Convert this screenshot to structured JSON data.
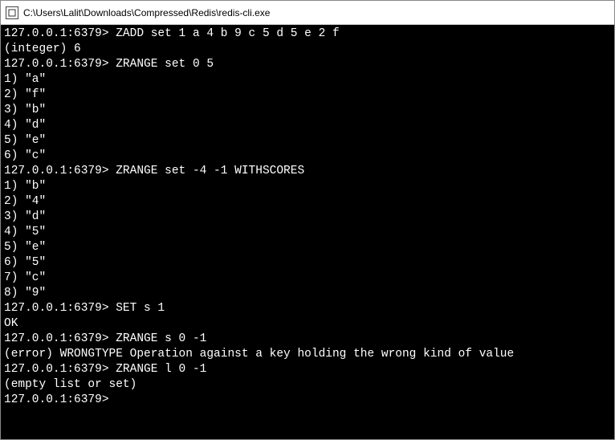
{
  "window": {
    "title": "C:\\Users\\Lalit\\Downloads\\Compressed\\Redis\\redis-cli.exe"
  },
  "terminal": {
    "prompt": "127.0.0.1:6379>",
    "blocks": [
      {
        "command": "ZADD set 1 a 4 b 9 c 5 d 5 e 2 f",
        "output": [
          "(integer) 6"
        ]
      },
      {
        "command": "ZRANGE set 0 5",
        "output": [
          "1) \"a\"",
          "2) \"f\"",
          "3) \"b\"",
          "4) \"d\"",
          "5) \"e\"",
          "6) \"c\""
        ]
      },
      {
        "command": "ZRANGE set -4 -1 WITHSCORES",
        "output": [
          "1) \"b\"",
          "2) \"4\"",
          "3) \"d\"",
          "4) \"5\"",
          "5) \"e\"",
          "6) \"5\"",
          "7) \"c\"",
          "8) \"9\""
        ]
      },
      {
        "command": "SET s 1",
        "output": [
          "OK"
        ]
      },
      {
        "command": "ZRANGE s 0 -1",
        "output": [
          "(error) WRONGTYPE Operation against a key holding the wrong kind of value"
        ]
      },
      {
        "command": "ZRANGE l 0 -1",
        "output": [
          "(empty list or set)"
        ]
      }
    ]
  }
}
